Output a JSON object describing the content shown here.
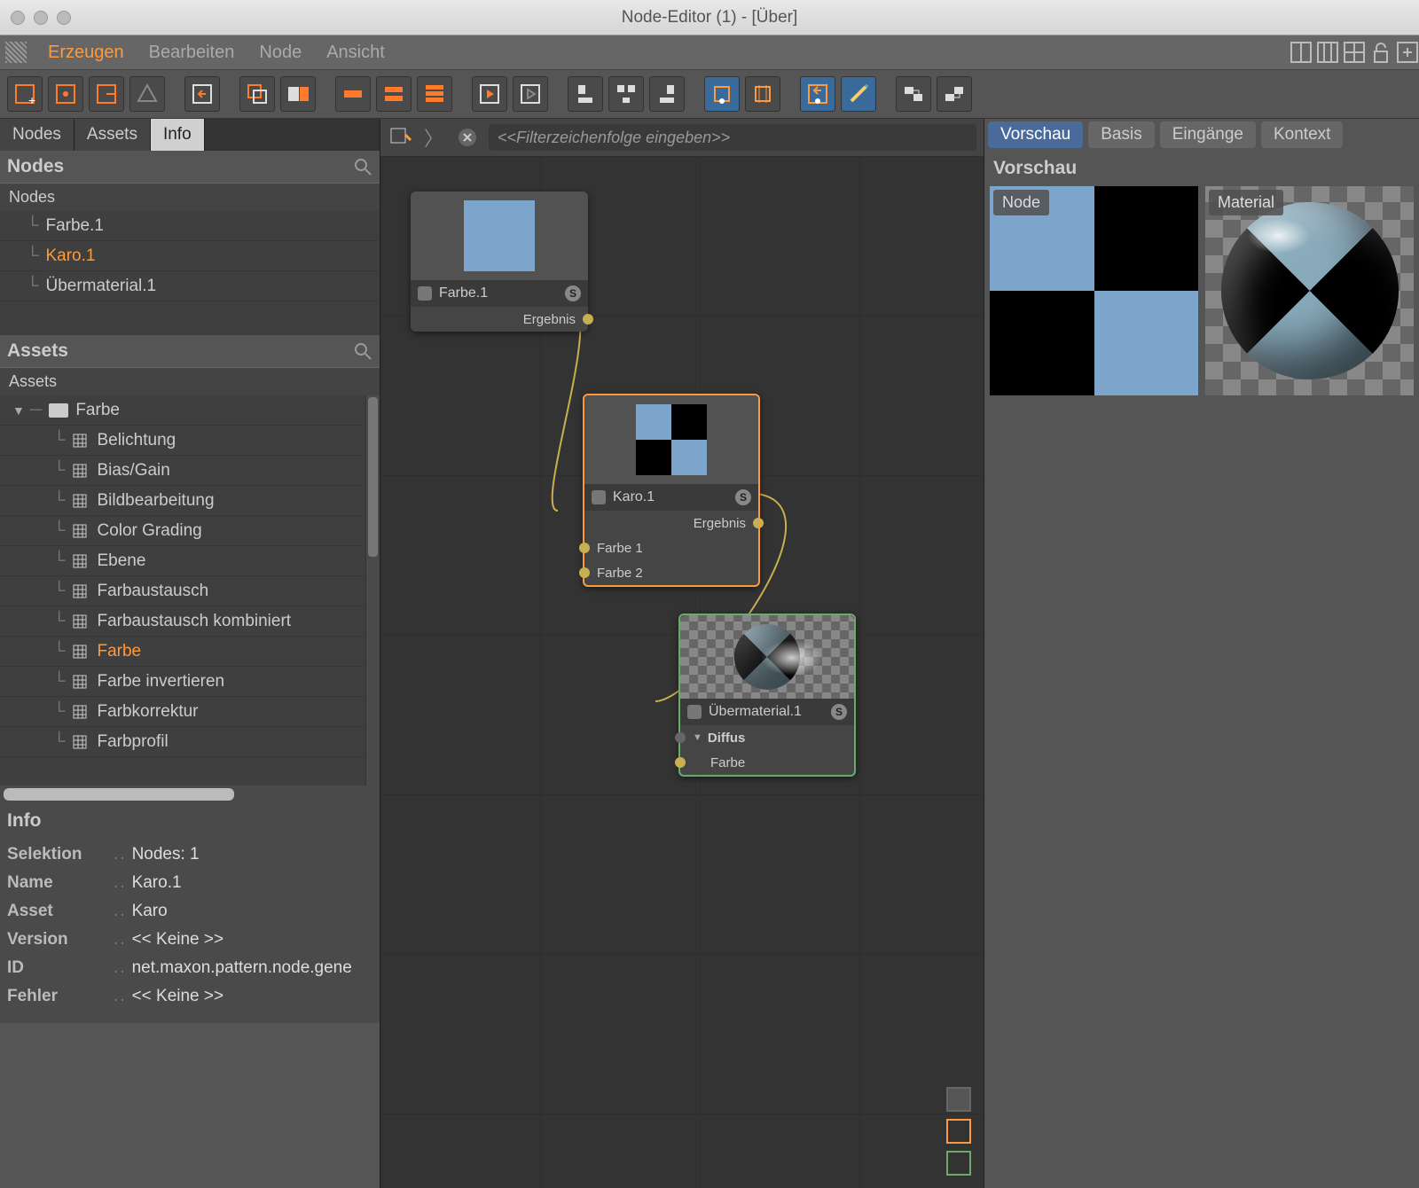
{
  "title": "Node-Editor (1) - [Über]",
  "menubar": {
    "items": [
      "Erzeugen",
      "Bearbeiten",
      "Node",
      "Ansicht"
    ],
    "activeIndex": 0
  },
  "sideTabs": {
    "items": [
      "Nodes",
      "Assets",
      "Info"
    ],
    "activeIndex": 2
  },
  "nodes": {
    "header": "Nodes",
    "listHeader": "Nodes",
    "items": [
      "Farbe.1",
      "Karo.1",
      "Übermaterial.1"
    ],
    "selectedIndex": 1
  },
  "assets": {
    "header": "Assets",
    "listHeader": "Assets",
    "folder": "Farbe",
    "items": [
      "Belichtung",
      "Bias/Gain",
      "Bildbearbeitung",
      "Color Grading",
      "Ebene",
      "Farbaustausch",
      "Farbaustausch kombiniert",
      "Farbe",
      "Farbe invertieren",
      "Farbkorrektur",
      "Farbprofil"
    ],
    "selectedIndex": 7
  },
  "info": {
    "header": "Info",
    "rows": [
      {
        "k": "Selektion",
        "v": "Nodes: 1"
      },
      {
        "k": "Name",
        "v": "Karo.1"
      },
      {
        "k": "Asset",
        "v": "Karo"
      },
      {
        "k": "Version",
        "v": "<< Keine >>"
      },
      {
        "k": "ID",
        "v": "net.maxon.pattern.node.gene"
      },
      {
        "k": "Fehler",
        "v": "<< Keine >>"
      }
    ]
  },
  "filterPlaceholder": "<<Filterzeichenfolge eingeben>>",
  "graph": {
    "node1": {
      "title": "Farbe.1",
      "out": "Ergebnis"
    },
    "node2": {
      "title": "Karo.1",
      "out": "Ergebnis",
      "in1": "Farbe 1",
      "in2": "Farbe 2"
    },
    "node3": {
      "title": "Übermaterial.1",
      "group": "Diffus",
      "in": "Farbe"
    }
  },
  "rightTabs": {
    "items": [
      "Vorschau",
      "Basis",
      "Eingänge",
      "Kontext"
    ],
    "activeIndex": 0
  },
  "preview": {
    "header": "Vorschau",
    "label1": "Node",
    "label2": "Material"
  },
  "colors": {
    "accentOrange": "#ff9a3a",
    "accentBlue": "#4a6a9a",
    "checkerBlue": "#7da5cc"
  }
}
